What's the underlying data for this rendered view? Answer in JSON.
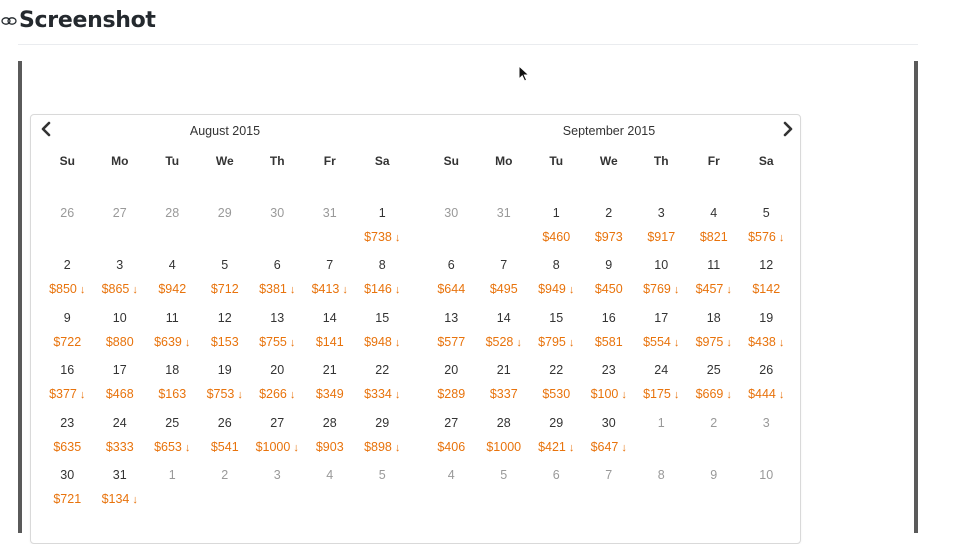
{
  "header": {
    "title": "Screenshot"
  },
  "calendar": {
    "left": {
      "title": "August 2015",
      "dow": [
        "Su",
        "Mo",
        "Tu",
        "We",
        "Th",
        "Fr",
        "Sa"
      ],
      "weeks": [
        [
          {
            "d": "26",
            "off": true
          },
          {
            "d": "27",
            "off": true
          },
          {
            "d": "28",
            "off": true
          },
          {
            "d": "29",
            "off": true
          },
          {
            "d": "30",
            "off": true
          },
          {
            "d": "31",
            "off": true
          },
          {
            "d": "1",
            "p": "$738",
            "down": true
          }
        ],
        [
          {
            "d": "2",
            "p": "$850",
            "down": true
          },
          {
            "d": "3",
            "p": "$865",
            "down": true
          },
          {
            "d": "4",
            "p": "$942"
          },
          {
            "d": "5",
            "p": "$712"
          },
          {
            "d": "6",
            "p": "$381",
            "down": true
          },
          {
            "d": "7",
            "p": "$413",
            "down": true
          },
          {
            "d": "8",
            "p": "$146",
            "down": true
          }
        ],
        [
          {
            "d": "9",
            "p": "$722"
          },
          {
            "d": "10",
            "p": "$880"
          },
          {
            "d": "11",
            "p": "$639",
            "down": true
          },
          {
            "d": "12",
            "p": "$153"
          },
          {
            "d": "13",
            "p": "$755",
            "down": true
          },
          {
            "d": "14",
            "p": "$141"
          },
          {
            "d": "15",
            "p": "$948",
            "down": true
          }
        ],
        [
          {
            "d": "16",
            "p": "$377",
            "down": true
          },
          {
            "d": "17",
            "p": "$468"
          },
          {
            "d": "18",
            "p": "$163"
          },
          {
            "d": "19",
            "p": "$753",
            "down": true
          },
          {
            "d": "20",
            "p": "$266",
            "down": true
          },
          {
            "d": "21",
            "p": "$349"
          },
          {
            "d": "22",
            "p": "$334",
            "down": true
          }
        ],
        [
          {
            "d": "23",
            "p": "$635"
          },
          {
            "d": "24",
            "p": "$333"
          },
          {
            "d": "25",
            "p": "$653",
            "down": true
          },
          {
            "d": "26",
            "p": "$541"
          },
          {
            "d": "27",
            "p": "$1000",
            "down": true
          },
          {
            "d": "28",
            "p": "$903"
          },
          {
            "d": "29",
            "p": "$898",
            "down": true
          }
        ],
        [
          {
            "d": "30",
            "p": "$721"
          },
          {
            "d": "31",
            "p": "$134",
            "down": true
          },
          {
            "d": "1",
            "off": true
          },
          {
            "d": "2",
            "off": true
          },
          {
            "d": "3",
            "off": true
          },
          {
            "d": "4",
            "off": true
          },
          {
            "d": "5",
            "off": true
          }
        ]
      ]
    },
    "right": {
      "title": "September 2015",
      "dow": [
        "Su",
        "Mo",
        "Tu",
        "We",
        "Th",
        "Fr",
        "Sa"
      ],
      "weeks": [
        [
          {
            "d": "30",
            "off": true
          },
          {
            "d": "31",
            "off": true
          },
          {
            "d": "1",
            "p": "$460"
          },
          {
            "d": "2",
            "p": "$973"
          },
          {
            "d": "3",
            "p": "$917"
          },
          {
            "d": "4",
            "p": "$821"
          },
          {
            "d": "5",
            "p": "$576",
            "down": true
          }
        ],
        [
          {
            "d": "6",
            "p": "$644"
          },
          {
            "d": "7",
            "p": "$495"
          },
          {
            "d": "8",
            "p": "$949",
            "down": true
          },
          {
            "d": "9",
            "p": "$450"
          },
          {
            "d": "10",
            "p": "$769",
            "down": true
          },
          {
            "d": "11",
            "p": "$457",
            "down": true
          },
          {
            "d": "12",
            "p": "$142"
          }
        ],
        [
          {
            "d": "13",
            "p": "$577"
          },
          {
            "d": "14",
            "p": "$528",
            "down": true
          },
          {
            "d": "15",
            "p": "$795",
            "down": true
          },
          {
            "d": "16",
            "p": "$581"
          },
          {
            "d": "17",
            "p": "$554",
            "down": true
          },
          {
            "d": "18",
            "p": "$975",
            "down": true
          },
          {
            "d": "19",
            "p": "$438",
            "down": true
          }
        ],
        [
          {
            "d": "20",
            "p": "$289"
          },
          {
            "d": "21",
            "p": "$337"
          },
          {
            "d": "22",
            "p": "$530"
          },
          {
            "d": "23",
            "p": "$100",
            "down": true
          },
          {
            "d": "24",
            "p": "$175",
            "down": true
          },
          {
            "d": "25",
            "p": "$669",
            "down": true
          },
          {
            "d": "26",
            "p": "$444",
            "down": true
          }
        ],
        [
          {
            "d": "27",
            "p": "$406"
          },
          {
            "d": "28",
            "p": "$1000"
          },
          {
            "d": "29",
            "p": "$421",
            "down": true
          },
          {
            "d": "30",
            "p": "$647",
            "down": true
          },
          {
            "d": "1",
            "off": true
          },
          {
            "d": "2",
            "off": true
          },
          {
            "d": "3",
            "off": true
          }
        ],
        [
          {
            "d": "4",
            "off": true
          },
          {
            "d": "5",
            "off": true
          },
          {
            "d": "6",
            "off": true
          },
          {
            "d": "7",
            "off": true
          },
          {
            "d": "8",
            "off": true
          },
          {
            "d": "9",
            "off": true
          },
          {
            "d": "10",
            "off": true
          }
        ]
      ]
    },
    "colors": {
      "price": "#e8730c",
      "off_day": "#999999",
      "day": "#333333"
    },
    "icons": {
      "prev": "chevron-left-icon",
      "next": "chevron-right-icon",
      "price_drop": "arrow-down-icon"
    }
  }
}
